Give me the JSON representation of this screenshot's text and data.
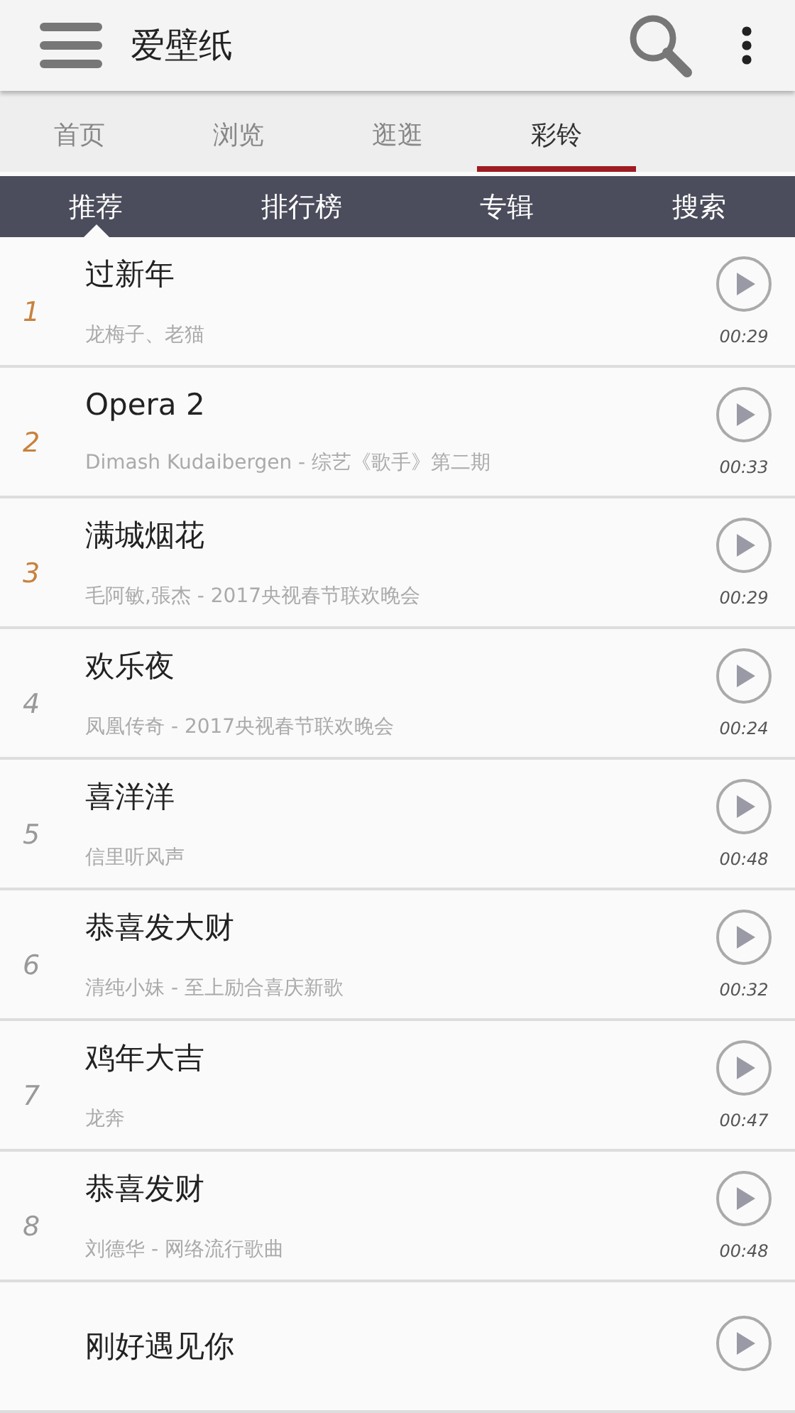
{
  "app_bar": {
    "title": "爱壁纸"
  },
  "tabs": [
    {
      "label": "首页",
      "selected": false
    },
    {
      "label": "浏览",
      "selected": false
    },
    {
      "label": "逛逛",
      "selected": false
    },
    {
      "label": "彩铃",
      "selected": true
    }
  ],
  "sub_tabs": [
    {
      "label": "推荐",
      "selected": true
    },
    {
      "label": "排行榜",
      "selected": false
    },
    {
      "label": "专辑",
      "selected": false
    },
    {
      "label": "搜索",
      "selected": false
    }
  ],
  "songs": [
    {
      "rank": "1",
      "top": true,
      "title": "过新年",
      "artist": "龙梅子、老猫",
      "duration": "00:29"
    },
    {
      "rank": "2",
      "top": true,
      "title": "Opera 2",
      "artist": "Dimash Kudaibergen - 综艺《歌手》第二期",
      "duration": "00:33"
    },
    {
      "rank": "3",
      "top": true,
      "title": "满城烟花",
      "artist": "毛阿敏,張杰 - 2017央视春节联欢晚会",
      "duration": "00:29"
    },
    {
      "rank": "4",
      "top": false,
      "title": "欢乐夜",
      "artist": "凤凰传奇 - 2017央视春节联欢晚会",
      "duration": "00:24"
    },
    {
      "rank": "5",
      "top": false,
      "title": "喜洋洋",
      "artist": "信里听风声",
      "duration": "00:48"
    },
    {
      "rank": "6",
      "top": false,
      "title": "恭喜发大财",
      "artist": "清纯小妹 - 至上励合喜庆新歌",
      "duration": "00:32"
    },
    {
      "rank": "7",
      "top": false,
      "title": "鸡年大吉",
      "artist": "龙奔",
      "duration": "00:47"
    },
    {
      "rank": "8",
      "top": false,
      "title": "恭喜发财",
      "artist": "刘德华 - 网络流行歌曲",
      "duration": "00:48"
    },
    {
      "title": "刚好遇见你"
    }
  ]
}
